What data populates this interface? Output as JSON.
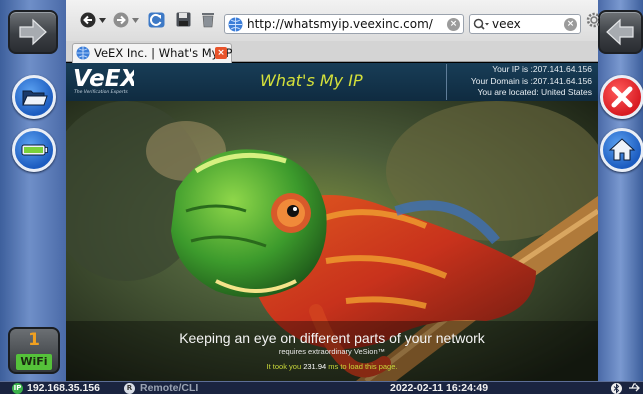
{
  "side_left": {
    "forward_icon": "arrow-right-icon",
    "folder_icon": "folder-icon",
    "battery_icon": "battery-icon",
    "wifi": {
      "count": "1",
      "label": "WiFi"
    }
  },
  "side_right": {
    "back_icon": "arrow-left-icon",
    "close_icon": "close-icon",
    "home_icon": "home-icon"
  },
  "browser": {
    "url": "http://whatsmyip.veexinc.com/",
    "search_value": "veex",
    "tab_title": "VeEX Inc. | What's My IP",
    "toolbar_icons": [
      "back-icon",
      "dropdown-icon",
      "forward-icon",
      "dropdown-icon",
      "reload-icon",
      "save-icon",
      "trash-icon",
      "gear-icon"
    ]
  },
  "page": {
    "logo_text": "VeEX",
    "logo_tagline": "The Verification Experts",
    "title": "What's My IP",
    "ip_line": "Your IP is :207.141.64.156",
    "domain_line": "Your Domain is :207.141.64.156",
    "location_line": "You are located: United States",
    "tagline": "Keeping an eye on different parts of your network",
    "subtagline": "requires extraordinary VeSion™",
    "load_prefix": "It took you",
    "load_ms": "231.94",
    "load_suffix": "ms to load this page."
  },
  "statusbar": {
    "ip_badge": "IP",
    "ip": "192.168.35.156",
    "remote_badge": "R",
    "remote": "Remote/CLI",
    "datetime": "2022-02-11 16:24:49"
  },
  "colors": {
    "rail": "#6f8fc8",
    "close_red": "#e8242b",
    "accent_blue": "#2f6fd0",
    "title_yellow": "#d4e03a",
    "wifi_green": "#55c23a"
  }
}
